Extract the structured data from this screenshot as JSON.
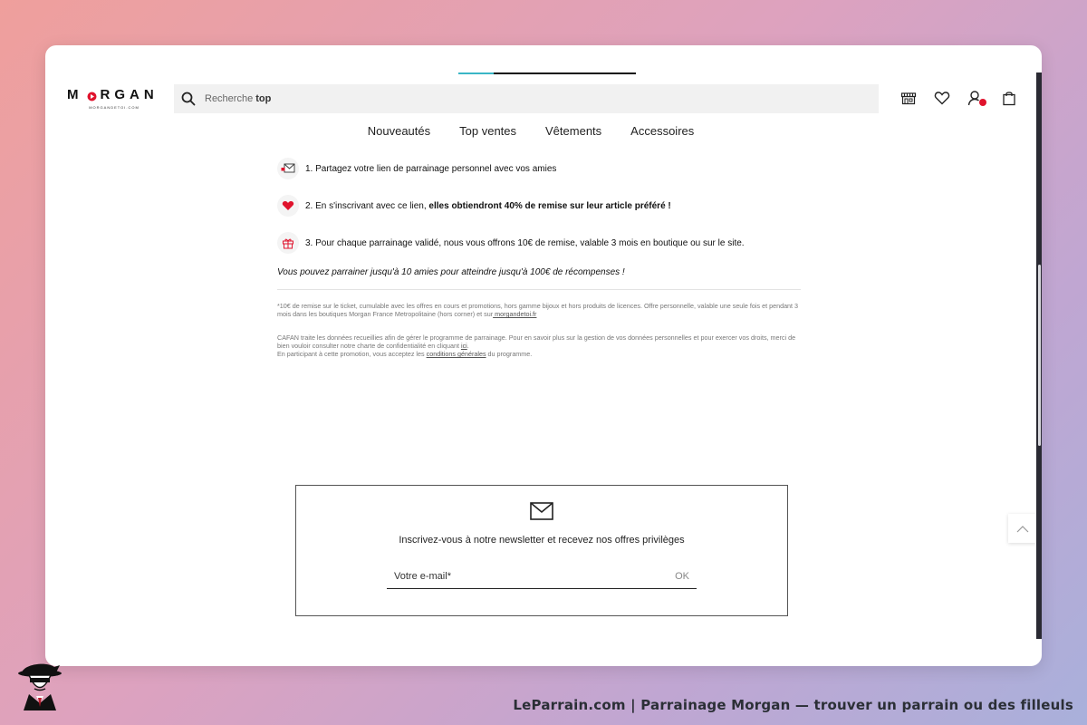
{
  "brand": {
    "name": "MORGAN",
    "tagline": "MORGANDETOI.COM",
    "accent": "#e0132d"
  },
  "search": {
    "placeholder_prefix": "Recherche ",
    "placeholder_highlight": "top"
  },
  "header_icons": [
    "store-icon",
    "heart-icon",
    "account-icon",
    "bag-icon"
  ],
  "loading_progress": 0.2,
  "nav": {
    "items": [
      "Nouveautés",
      "Top ventes",
      "Vêtements",
      "Accessoires"
    ]
  },
  "steps": [
    {
      "icon": "envelope-send-icon",
      "text": "1. Partagez votre lien de parrainage personnel avec vos amies",
      "bold": ""
    },
    {
      "icon": "red-heart-icon",
      "text": "2. En s'inscrivant avec ce lien, ",
      "bold": "elles obtiendront 40% de remise sur leur article préféré !"
    },
    {
      "icon": "gift-icon",
      "text": "3. Pour chaque parrainage validé, nous vous offrons 10€ de remise, valable 3 mois en boutique ou sur le site.",
      "bold": ""
    }
  ],
  "promo_line": "Vous pouvez parrainer jusqu'à 10 amies pour atteindre jusqu'à 100€ de récompenses !",
  "fine_print": {
    "p1_text": "*10€ de remise sur le ticket, cumulable avec les offres en cours et promotions, hors gamme bijoux et hors produits de licences. Offre personnelle, valable une seule fois et pendant 3 mois dans les boutiques Morgan France Metropolitaine (hors corner) et sur",
    "p1_link": " morgandetoi.fr",
    "p2_text": "CAFAN traite les données recueillies afin de gérer le programme de parrainage. Pour en savoir plus sur la gestion de vos données personnelles et pour exercer vos droits, merci de bien vouloir consulter notre charte de confidentialité en cliquant ",
    "p2_link": "ici",
    "p3_text": "En participant à cette promotion, vous acceptez les ",
    "p3_link": "conditions générales",
    "p3_end": " du programme."
  },
  "newsletter": {
    "title": "Inscrivez-vous à notre newsletter et recevez nos offres privilèges",
    "email_placeholder": "Votre e-mail*",
    "submit": "OK"
  },
  "footer": {
    "caption": "LeParrain.com | Parrainage Morgan — trouver un parrain ou des filleuls"
  }
}
